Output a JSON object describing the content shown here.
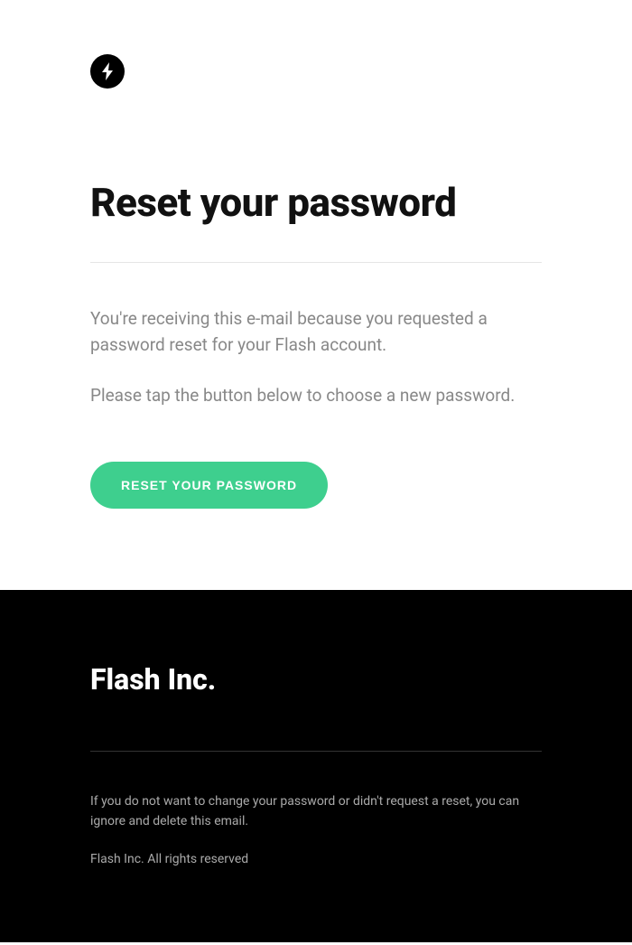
{
  "header": {
    "title": "Reset your password"
  },
  "body": {
    "paragraph1": "You're receiving this e-mail because you requested a password reset for your Flash account.",
    "paragraph2": "Please tap the button below to choose a new password.",
    "button_label": "RESET YOUR PASSWORD"
  },
  "footer": {
    "company_name": "Flash Inc.",
    "disclaimer": "If you do not want to change your password or didn't request a reset, you can ignore and delete this email.",
    "copyright": "Flash Inc. All rights reserved"
  },
  "colors": {
    "accent": "#3ecf8e",
    "text_dark": "#111111",
    "text_muted": "#888888",
    "footer_bg": "#000000"
  }
}
